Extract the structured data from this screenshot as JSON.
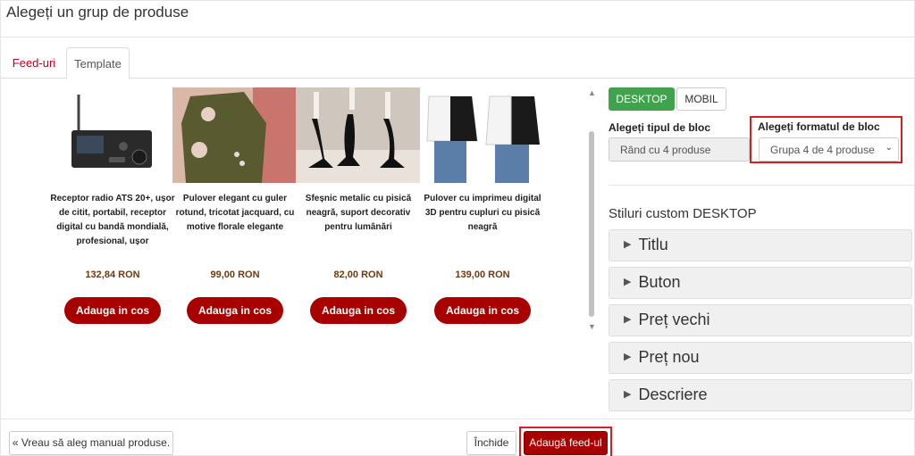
{
  "header": {
    "title": "Alegeți un grup de produse"
  },
  "tabs": [
    {
      "label": "Feed-uri"
    },
    {
      "label": "Template"
    }
  ],
  "products": [
    {
      "name": "Receptor radio ATS 20+, ușor de citit, portabil, receptor digital cu bandă mondială, profesional, ușor",
      "price": "132,84 RON",
      "button": "Adauga in cos",
      "image_icon": "radio-receiver-image"
    },
    {
      "name": "Pulover elegant cu guler rotund, tricotat jacquard, cu motive florale elegante",
      "price": "99,00 RON",
      "button": "Adauga in cos",
      "image_icon": "green-sweater-image"
    },
    {
      "name": "Sfeșnic metalic cu pisică neagră, suport decorativ pentru lumânări",
      "price": "82,00 RON",
      "button": "Adauga in cos",
      "image_icon": "cat-candlestick-image"
    },
    {
      "name": "Pulover cu imprimeu digital 3D pentru cupluri cu pisică neagră",
      "price": "139,00 RON",
      "button": "Adauga in cos",
      "image_icon": "couple-hoodies-image"
    }
  ],
  "device_tabs": {
    "desktop": "DESKTOP",
    "mobile": "MOBIL"
  },
  "block_type": {
    "label": "Alegeți tipul de bloc",
    "value": "Rând cu 4 produse"
  },
  "block_format": {
    "label": "Alegeți formatul de bloc",
    "value": "Grupa 4 de 4 produse"
  },
  "custom_styles": {
    "title": "Stiluri custom DESKTOP",
    "sections": [
      "Titlu",
      "Buton",
      "Preț vechi",
      "Preț nou",
      "Descriere"
    ]
  },
  "footer": {
    "manual_label": "« Vreau să aleg manual produse.",
    "close_label": "Închide",
    "add_label": "Adaugă feed-ul"
  },
  "colors": {
    "accent": "#a80000",
    "active_device": "#3fa34d",
    "highlight": "#d42020"
  }
}
